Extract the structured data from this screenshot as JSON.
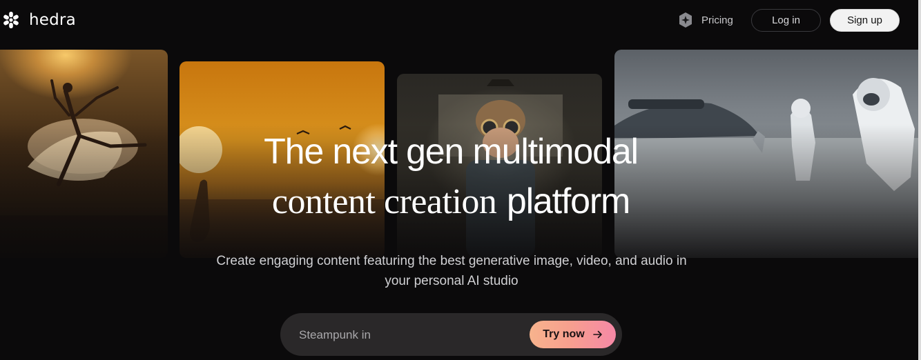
{
  "brand": {
    "name": "hedra",
    "logo_icon": "hedra-logo-icon"
  },
  "nav": {
    "pricing_label": "Pricing",
    "pricing_icon": "sparkle-icon",
    "login_label": "Log in",
    "signup_label": "Sign up"
  },
  "hero": {
    "line1": "The next gen multimodal",
    "line2_serif": "content creation",
    "line2_sans": "platform",
    "subtitle": "Create engaging content featuring the best generative image, video, and audio in your personal AI studio"
  },
  "gallery": [
    {
      "scene": "ballet-dancer"
    },
    {
      "scene": "desert-sunset-birds"
    },
    {
      "scene": "steampunk-boy-goggles"
    },
    {
      "scene": "astronauts-snow-dome"
    }
  ],
  "prompt": {
    "value": "Steampunk in",
    "button_label": "Try now",
    "button_icon": "arrow-right-icon"
  },
  "colors": {
    "background": "#0b0a0b",
    "accent_start": "#f7b38d",
    "accent_end": "#f688a6"
  }
}
